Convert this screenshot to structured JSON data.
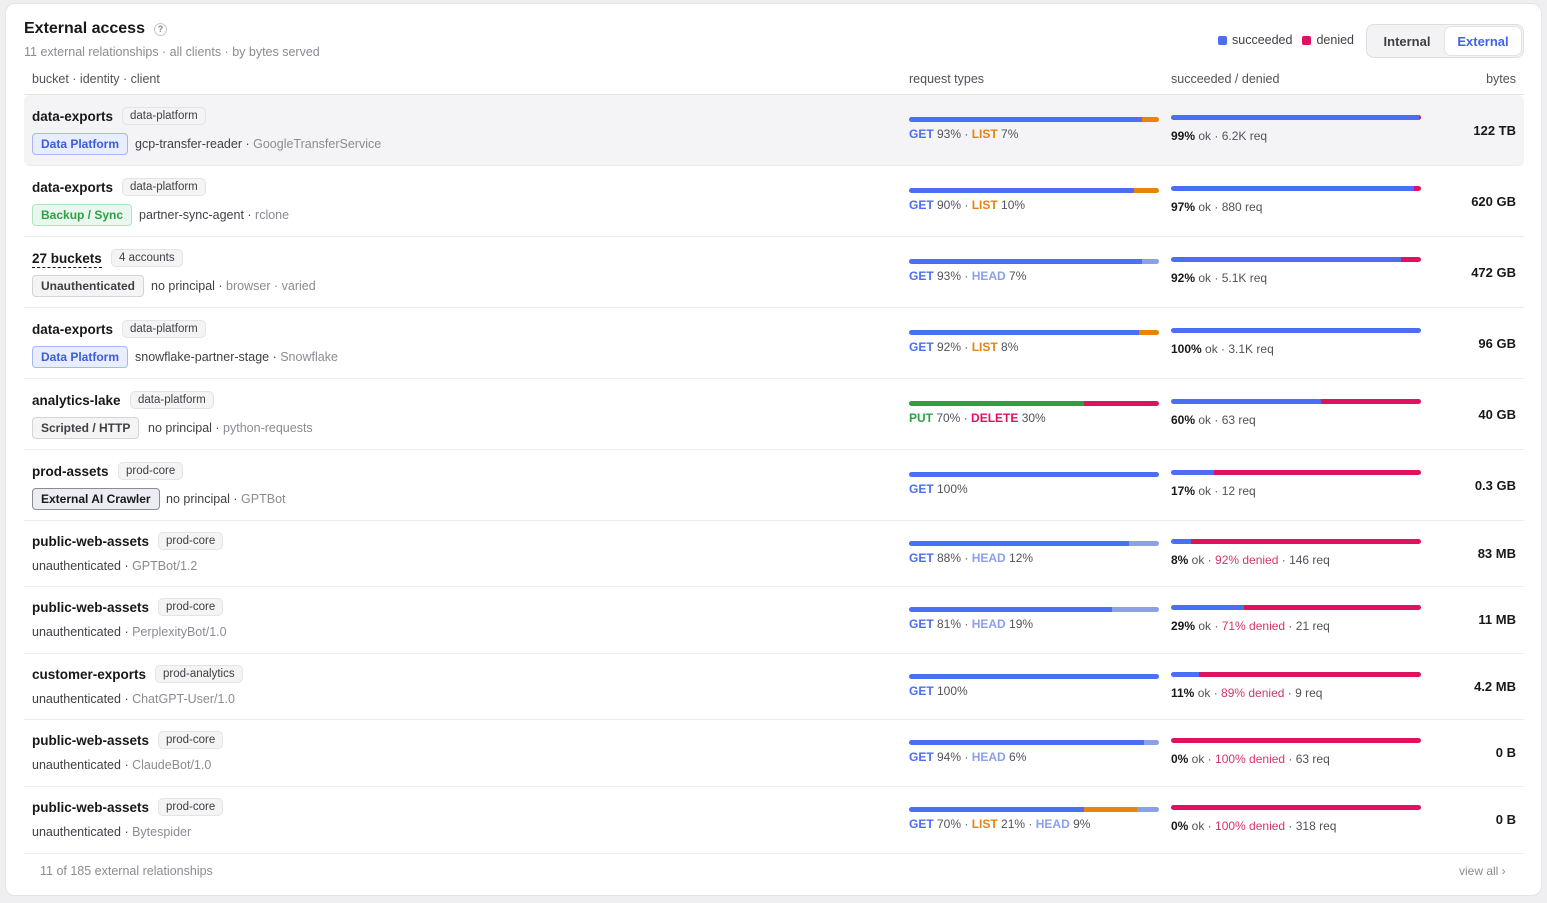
{
  "header": {
    "title": "External access",
    "help_icon": "?",
    "subtitle": "11 external relationships · all clients · by bytes served"
  },
  "legend": [
    {
      "label": "succeeded",
      "color": "#4c6ef5"
    },
    {
      "label": "denied",
      "color": "#e0115f"
    }
  ],
  "toggle": {
    "internal": "Internal",
    "external": "External",
    "selected": "External"
  },
  "columns": {
    "bucket": "bucket · identity · client",
    "request_types": "request types",
    "succeeded": "succeeded / denied",
    "bytes": "bytes"
  },
  "colors": {
    "GET": "#4c6ef5",
    "LIST": "#e8830c",
    "HEAD": "#8ca0e8",
    "PUT": "#2f9e44",
    "DELETE": "#e0115f",
    "ok": "#4c6ef5",
    "denied": "#e0115f"
  },
  "rows": [
    {
      "bucket": "data-exports",
      "account": "data-platform",
      "tag": "Data Platform",
      "tag_style": "blue",
      "principal": "gcp-transfer-reader",
      "client": "GoogleTransferService",
      "requests": [
        {
          "method": "GET",
          "pct": 93
        },
        {
          "method": "LIST",
          "pct": 7
        }
      ],
      "ok_pct": 99,
      "denied_pct": null,
      "req": "6.2K req",
      "bytes": "122 TB"
    },
    {
      "bucket": "data-exports",
      "account": "data-platform",
      "tag": "Backup / Sync",
      "tag_style": "green",
      "principal": "partner-sync-agent",
      "client": "rclone",
      "requests": [
        {
          "method": "GET",
          "pct": 90
        },
        {
          "method": "LIST",
          "pct": 10
        }
      ],
      "ok_pct": 97,
      "denied_pct": null,
      "req": "880 req",
      "bytes": "620 GB"
    },
    {
      "bucket": "27 buckets",
      "account": "4 accounts",
      "tag": "Unauthenticated",
      "tag_style": "gray",
      "principal": "no principal",
      "client": "browser · varied",
      "requests": [
        {
          "method": "GET",
          "pct": 93
        },
        {
          "method": "HEAD",
          "pct": 7
        }
      ],
      "ok_pct": 92,
      "denied_pct": null,
      "req": "5.1K req",
      "bytes": "472 GB"
    },
    {
      "bucket": "data-exports",
      "account": "data-platform",
      "tag": "Data Platform",
      "tag_style": "blue",
      "principal": "snowflake-partner-stage",
      "client": "Snowflake",
      "requests": [
        {
          "method": "GET",
          "pct": 92
        },
        {
          "method": "LIST",
          "pct": 8
        }
      ],
      "ok_pct": 100,
      "denied_pct": null,
      "req": "3.1K req",
      "bytes": "96 GB"
    },
    {
      "bucket": "analytics-lake",
      "account": "data-platform",
      "tag": "Scripted / HTTP",
      "tag_style": "gray",
      "principal": "no principal",
      "client": "python-requests",
      "requests": [
        {
          "method": "PUT",
          "pct": 70
        },
        {
          "method": "DELETE",
          "pct": 30
        }
      ],
      "ok_pct": 60,
      "denied_pct": null,
      "req": "63 req",
      "bytes": "40 GB"
    },
    {
      "bucket": "prod-assets",
      "account": "prod-core",
      "tag": "External AI Crawler",
      "tag_style": "dark",
      "principal": "no principal",
      "client": "GPTBot",
      "requests": [
        {
          "method": "GET",
          "pct": 100
        }
      ],
      "ok_pct": 17,
      "denied_pct": null,
      "req": "12 req",
      "bytes": "0.3 GB"
    },
    {
      "bucket": "public-web-assets",
      "account": "prod-core",
      "tag": null,
      "tag_style": null,
      "principal": "unauthenticated",
      "client": "GPTBot/1.2",
      "requests": [
        {
          "method": "GET",
          "pct": 88
        },
        {
          "method": "HEAD",
          "pct": 12
        }
      ],
      "ok_pct": 8,
      "denied_pct": 92,
      "req": "146 req",
      "bytes": "83 MB"
    },
    {
      "bucket": "public-web-assets",
      "account": "prod-core",
      "tag": null,
      "tag_style": null,
      "principal": "unauthenticated",
      "client": "PerplexityBot/1.0",
      "requests": [
        {
          "method": "GET",
          "pct": 81
        },
        {
          "method": "HEAD",
          "pct": 19
        }
      ],
      "ok_pct": 29,
      "denied_pct": 71,
      "req": "21 req",
      "bytes": "11 MB"
    },
    {
      "bucket": "customer-exports",
      "account": "prod-analytics",
      "tag": null,
      "tag_style": null,
      "principal": "unauthenticated",
      "client": "ChatGPT-User/1.0",
      "requests": [
        {
          "method": "GET",
          "pct": 100
        }
      ],
      "ok_pct": 11,
      "denied_pct": 89,
      "req": "9 req",
      "bytes": "4.2 MB"
    },
    {
      "bucket": "public-web-assets",
      "account": "prod-core",
      "tag": null,
      "tag_style": null,
      "principal": "unauthenticated",
      "client": "ClaudeBot/1.0",
      "requests": [
        {
          "method": "GET",
          "pct": 94
        },
        {
          "method": "HEAD",
          "pct": 6
        }
      ],
      "ok_pct": 0,
      "denied_pct": 100,
      "req": "63 req",
      "bytes": "0 B"
    },
    {
      "bucket": "public-web-assets",
      "account": "prod-core",
      "tag": null,
      "tag_style": null,
      "principal": "unauthenticated",
      "client": "Bytespider",
      "requests": [
        {
          "method": "GET",
          "pct": 70
        },
        {
          "method": "LIST",
          "pct": 21
        },
        {
          "method": "HEAD",
          "pct": 9
        }
      ],
      "ok_pct": 0,
      "denied_pct": 100,
      "req": "318 req",
      "bytes": "0 B"
    }
  ],
  "footer": {
    "count": "11 of 185 external relationships",
    "view_all": "view all ›"
  }
}
